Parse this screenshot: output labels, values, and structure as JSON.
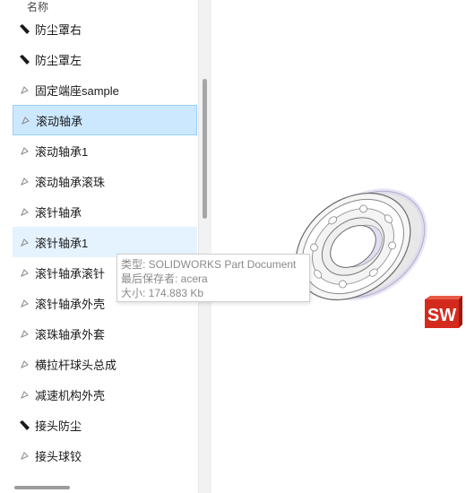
{
  "file_list": {
    "column_header": "名称",
    "items": [
      {
        "name": "防尘罩右",
        "icon": "part-dark-icon"
      },
      {
        "name": "防尘罩左",
        "icon": "part-dark-icon"
      },
      {
        "name": "固定端座sample",
        "icon": "part-gray-icon"
      },
      {
        "name": "滚动轴承",
        "icon": "part-gray-icon",
        "state": "selected"
      },
      {
        "name": "滚动轴承1",
        "icon": "part-gray-icon"
      },
      {
        "name": "滚动轴承滚珠",
        "icon": "part-gray-icon"
      },
      {
        "name": "滚针轴承",
        "icon": "part-gray-icon"
      },
      {
        "name": "滚针轴承1",
        "icon": "part-gray-icon",
        "state": "hover"
      },
      {
        "name": "滚针轴承滚针",
        "icon": "part-gray-icon"
      },
      {
        "name": "滚针轴承外壳",
        "icon": "part-gray-icon"
      },
      {
        "name": "滚珠轴承外套",
        "icon": "part-gray-icon"
      },
      {
        "name": "横拉杆球头总成",
        "icon": "part-gray-icon"
      },
      {
        "name": "减速机构外壳",
        "icon": "part-gray-icon"
      },
      {
        "name": "接头防尘",
        "icon": "part-dark-icon"
      },
      {
        "name": "接头球铰",
        "icon": "part-gray-icon"
      }
    ]
  },
  "tooltip": {
    "type_line": "类型: SOLIDWORKS Part Document",
    "saver_line": "最后保存者: acera",
    "size_line": "大小: 174.883 Kb"
  },
  "preview": {
    "thumbnail": "ball-bearing-3d-preview",
    "badge": "SOLIDWORKS-logo",
    "badge_text": "SW"
  },
  "colors": {
    "selected_bg": "#cce8ff",
    "hover_bg": "#e5f3ff",
    "badge_red": "#d42a1e"
  }
}
